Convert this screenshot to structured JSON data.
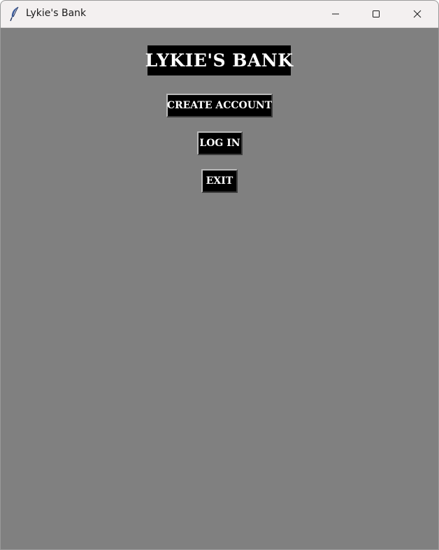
{
  "window": {
    "title": "Lykie's Bank",
    "icon": "feather-icon"
  },
  "heading": "LYKIE'S BANK",
  "buttons": {
    "create_account": "CREATE ACCOUNT",
    "log_in": "LOG IN",
    "exit": "EXIT"
  },
  "colors": {
    "background": "#808080",
    "button_bg": "#000000",
    "button_text": "#ffffff",
    "titlebar": "#f3f0f0"
  }
}
